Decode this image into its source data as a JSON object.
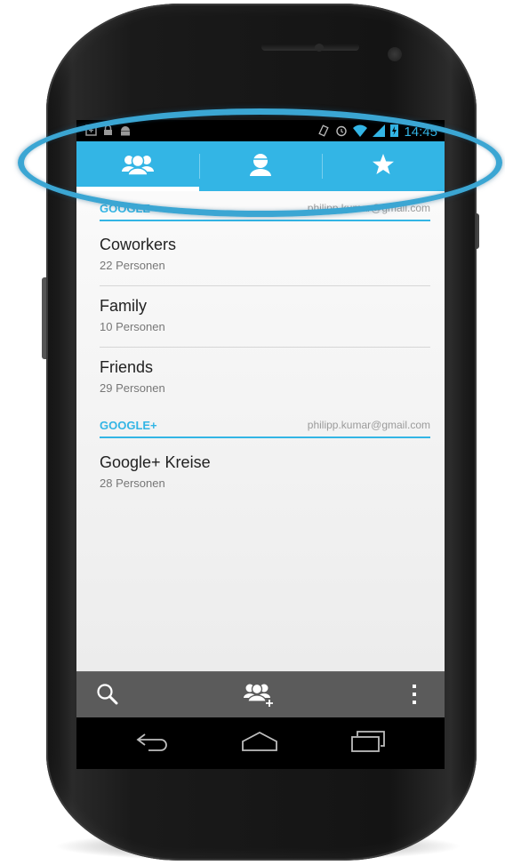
{
  "status_bar": {
    "time": "14:45",
    "left_icons": [
      "sync-icon",
      "lock-icon",
      "android-icon"
    ],
    "right_icons": [
      "vibrate-icon",
      "alarm-icon",
      "wifi-icon",
      "signal-icon",
      "battery-charging-icon"
    ]
  },
  "tabs": [
    {
      "icon": "groups-icon",
      "active": true
    },
    {
      "icon": "person-icon",
      "active": false
    },
    {
      "icon": "star-icon",
      "active": false
    }
  ],
  "sections": [
    {
      "title": "GOOGLE",
      "account": "philipp.kumar@gmail.com",
      "groups": [
        {
          "name": "Coworkers",
          "count": "22 Personen"
        },
        {
          "name": "Family",
          "count": "10 Personen"
        },
        {
          "name": "Friends",
          "count": "29 Personen"
        }
      ]
    },
    {
      "title": "GOOGLE+",
      "account": "philipp.kumar@gmail.com",
      "groups": [
        {
          "name": "Google+ Kreise",
          "count": "28 Personen"
        }
      ]
    }
  ],
  "action_bar": {
    "search_icon": "search-icon",
    "add_group_icon": "add-group-icon",
    "overflow_icon": "overflow-menu-icon"
  },
  "nav_bar": [
    "back-icon",
    "home-icon",
    "recents-icon"
  ],
  "colors": {
    "accent": "#33b5e5",
    "highlight": "#3ba6d3",
    "action_bar": "#5b5b5b"
  }
}
